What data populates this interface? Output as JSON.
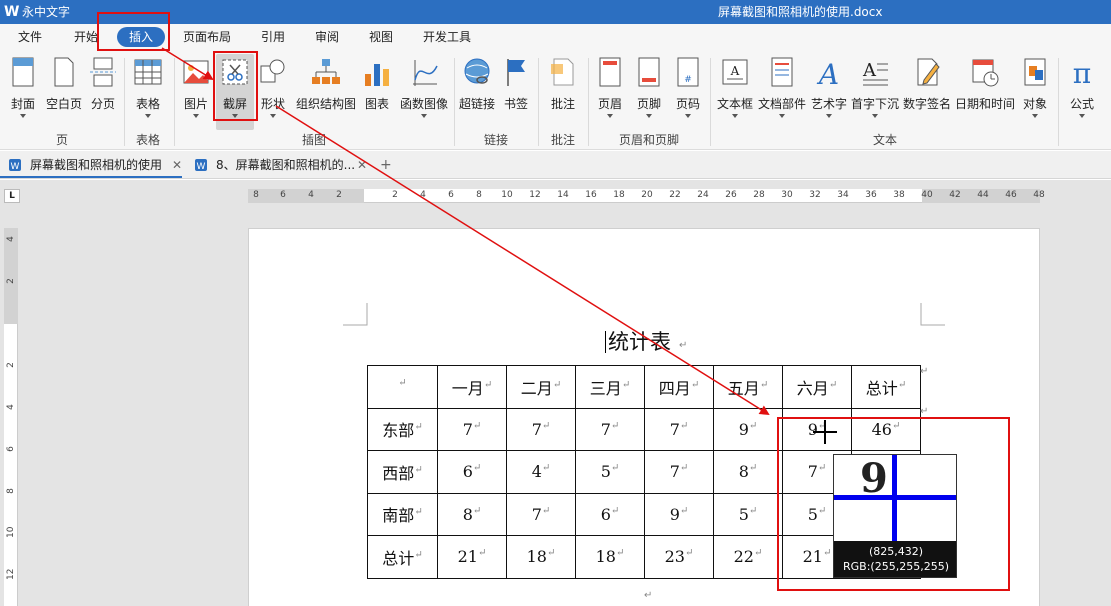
{
  "app": {
    "name": "永中文字",
    "logo": "W",
    "doc_title": "屏幕截图和照相机的使用.docx"
  },
  "menu": {
    "items": [
      "文件",
      "开始",
      "插入",
      "页面布局",
      "引用",
      "审阅",
      "视图",
      "开发工具"
    ],
    "active": "插入"
  },
  "ribbon": {
    "buttons": [
      {
        "label": "封面",
        "icon": "cover-page-icon"
      },
      {
        "label": "空白页",
        "icon": "blank-page-icon"
      },
      {
        "label": "分页",
        "icon": "page-break-icon"
      },
      {
        "label": "表格",
        "icon": "table-icon"
      },
      {
        "label": "图片",
        "icon": "picture-icon"
      },
      {
        "label": "截屏",
        "icon": "screenshot-icon"
      },
      {
        "label": "形状",
        "icon": "shapes-icon"
      },
      {
        "label": "组织结构图",
        "icon": "org-chart-icon"
      },
      {
        "label": "图表",
        "icon": "chart-icon"
      },
      {
        "label": "函数图像",
        "icon": "function-graph-icon"
      },
      {
        "label": "超链接",
        "icon": "hyperlink-icon"
      },
      {
        "label": "书签",
        "icon": "bookmark-icon"
      },
      {
        "label": "批注",
        "icon": "comment-icon"
      },
      {
        "label": "页眉",
        "icon": "header-icon"
      },
      {
        "label": "页脚",
        "icon": "footer-icon"
      },
      {
        "label": "页码",
        "icon": "page-number-icon"
      },
      {
        "label": "文本框",
        "icon": "text-box-icon"
      },
      {
        "label": "文档部件",
        "icon": "doc-parts-icon"
      },
      {
        "label": "艺术字",
        "icon": "word-art-icon"
      },
      {
        "label": "首字下沉",
        "icon": "drop-cap-icon"
      },
      {
        "label": "数字签名",
        "icon": "digital-signature-icon"
      },
      {
        "label": "日期和时间",
        "icon": "date-time-icon"
      },
      {
        "label": "对象",
        "icon": "object-icon"
      },
      {
        "label": "公式",
        "icon": "formula-icon"
      }
    ],
    "groups": [
      "页",
      "表格",
      "插图",
      "链接",
      "批注",
      "页眉和页脚",
      "文本"
    ]
  },
  "tabs": [
    {
      "label": "屏幕截图和照相机的使用",
      "active": true
    },
    {
      "label": "8、屏幕截图和照相机的...",
      "active": false
    }
  ],
  "ruler": {
    "corner": "L",
    "h_ticks": [
      "8",
      "6",
      "4",
      "2",
      "2",
      "4",
      "6",
      "8",
      "10",
      "12",
      "14",
      "16",
      "18",
      "20",
      "22",
      "24",
      "26",
      "28",
      "30",
      "32",
      "34",
      "36",
      "38",
      "40",
      "42",
      "44",
      "46",
      "48"
    ],
    "v_ticks": [
      "4",
      "2",
      "2",
      "4",
      "6",
      "8",
      "10",
      "12"
    ]
  },
  "document": {
    "title": "统计表",
    "paragraph_mark": "↵",
    "table": {
      "headers": [
        "",
        "一月",
        "二月",
        "三月",
        "四月",
        "五月",
        "六月",
        "总计"
      ],
      "rows": [
        [
          "东部",
          "7",
          "7",
          "7",
          "7",
          "9",
          "9",
          "46"
        ],
        [
          "西部",
          "6",
          "4",
          "5",
          "7",
          "8",
          "7",
          ""
        ],
        [
          "南部",
          "8",
          "7",
          "6",
          "9",
          "5",
          "5",
          ""
        ],
        [
          "总计",
          "21",
          "18",
          "18",
          "23",
          "22",
          "21",
          ""
        ]
      ]
    }
  },
  "magnifier": {
    "digit": "9",
    "coords": "(825,432)",
    "rgb": "RGB:(255,255,255)"
  },
  "colors": {
    "accent": "#2c6fc1",
    "annotation": "#e01010",
    "crosshair": "#0000ee"
  }
}
